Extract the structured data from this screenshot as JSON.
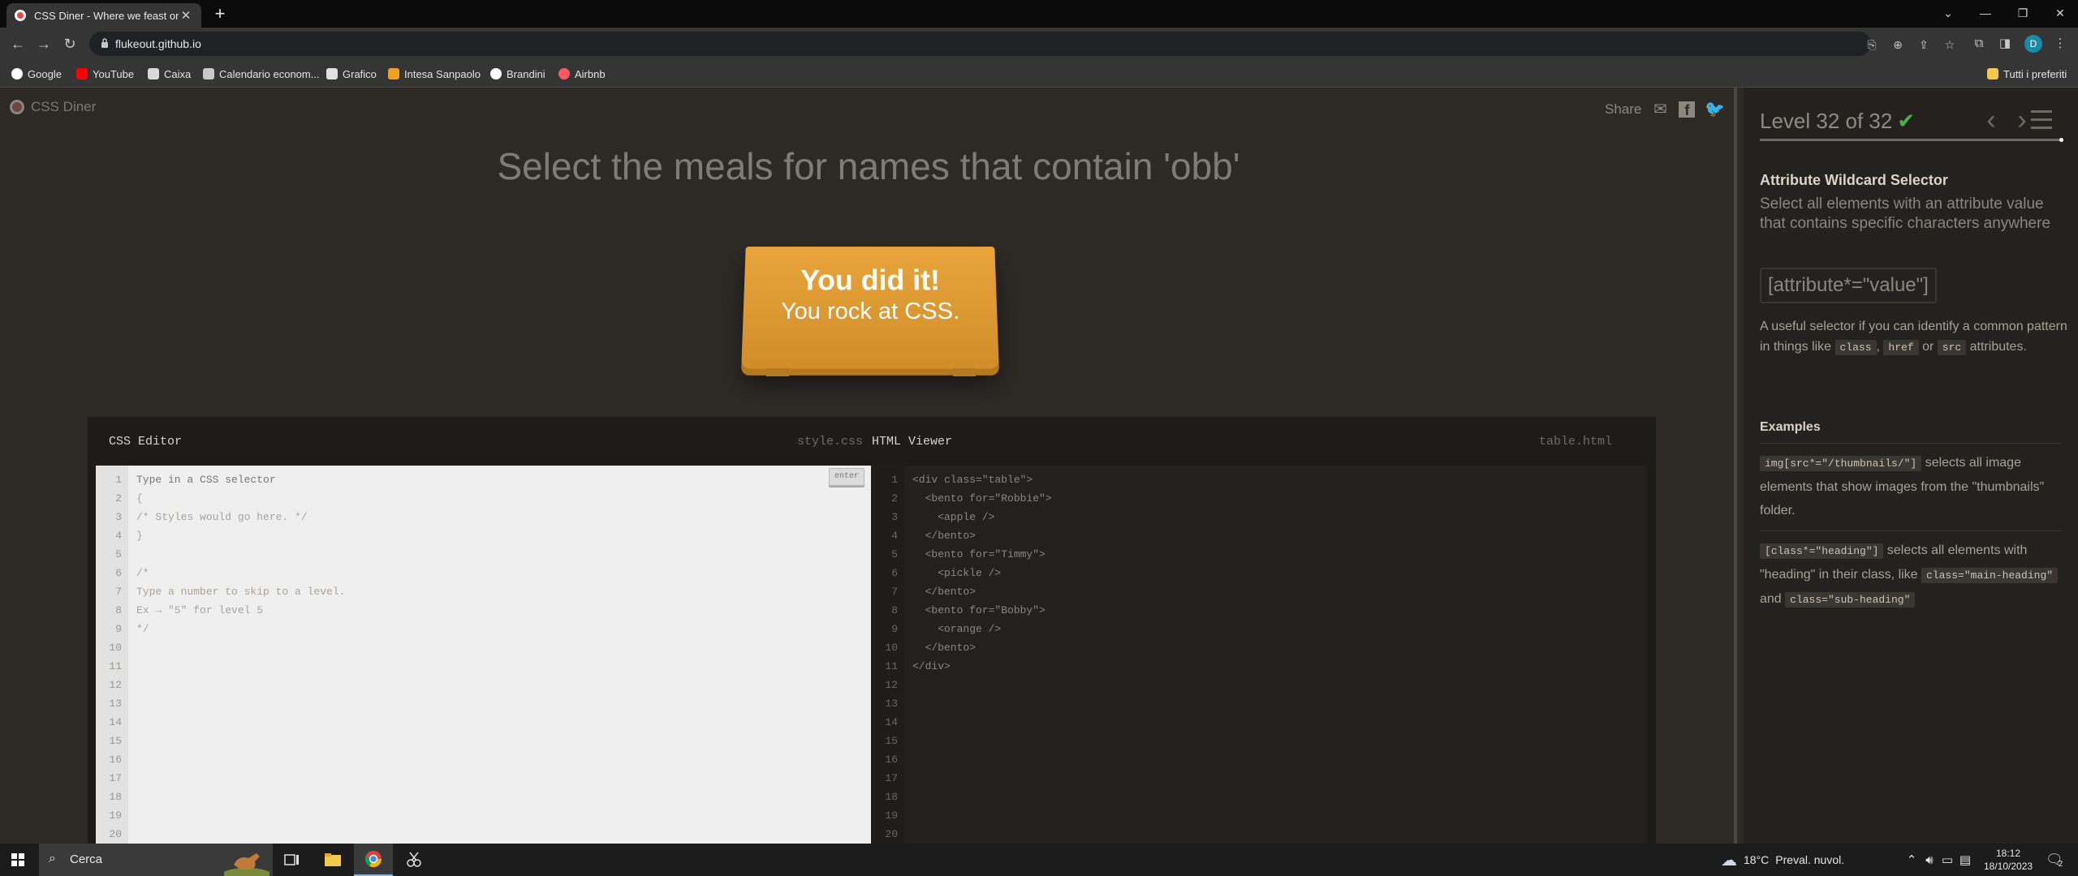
{
  "browser": {
    "tab_title": "CSS Diner - Where we feast on C",
    "url": "flukeout.github.io",
    "profile_initial": "D",
    "bookmarks": [
      "Google",
      "YouTube",
      "Caixa",
      "Calendario econom...",
      "Grafico",
      "Intesa Sanpaolo",
      "Brandini",
      "Airbnb"
    ],
    "all_bookmarks_label": "Tutti i preferiti"
  },
  "game": {
    "logo_text": "CSS Diner",
    "share_label": "Share",
    "order_text": "Select the meals for names that contain 'obb'",
    "win_line1": "You did it!",
    "win_line2": "You rock at CSS."
  },
  "css_editor": {
    "title": "CSS Editor",
    "file": "style.css",
    "enter_label": "enter",
    "input_placeholder": "Type in a CSS selector",
    "lines": [
      "{",
      "/* Styles would go here. */",
      "}",
      "",
      "/*",
      "Type a number to skip to a level.",
      "Ex → \"5\" for level 5",
      "*/"
    ],
    "line_count": 20
  },
  "html_viewer": {
    "title": "HTML Viewer",
    "file": "table.html",
    "lines": [
      "<div class=\"table\">",
      "  <bento for=\"Robbie\">",
      "    <apple />",
      "  </bento>",
      "  <bento for=\"Timmy\">",
      "    <pickle />",
      "  </bento>",
      "  <bento for=\"Bobby\">",
      "    <orange />",
      "  </bento>",
      "</div>"
    ],
    "line_count": 20
  },
  "sidebar": {
    "level_label": "Level 32 of 32",
    "progress_fraction": 1.0,
    "selector_name": "Attribute Wildcard Selector",
    "title": "Select all elements with an attribute value that contains specific characters anywhere",
    "syntax": "[attribute*=\"value\"]",
    "hint_pre": "A useful selector if you can identify a common pattern in things like",
    "hint_tag1": "class",
    "hint_sep": ",",
    "hint_tag2": "href",
    "hint_or": "or",
    "hint_tag3": "src",
    "hint_post": "attributes.",
    "examples_title": "Examples",
    "example1_code": "img[src*=\"/thumbnails/\"]",
    "example1_text": "selects all image elements that show images from the \"thumbnails\" folder.",
    "example2_code": "[class*=\"heading\"]",
    "example2_text": "selects all elements with \"heading\" in their class, like",
    "example2_tag1": "class=\"main-heading\"",
    "example2_and": "and",
    "example2_tag2": "class=\"sub-heading\""
  },
  "taskbar": {
    "search_text": "Cerca",
    "weather": "18°C",
    "weather_text": "Preval. nuvol.",
    "time": "18:12",
    "date": "18/10/2023",
    "notifications": "2"
  },
  "colors": {
    "background": "#2d2a26",
    "plate": "#e9a53c",
    "check": "#4caf50"
  }
}
